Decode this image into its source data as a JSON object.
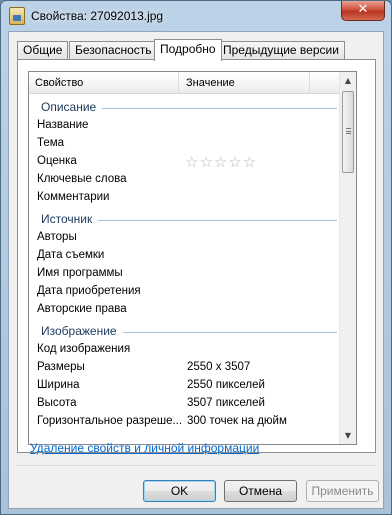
{
  "window": {
    "title": "Свойства: 27092013.jpg",
    "close_symbol": "✕"
  },
  "tabs": [
    {
      "label": "Общие",
      "active": false
    },
    {
      "label": "Безопасность",
      "active": false
    },
    {
      "label": "Подробно",
      "active": true
    },
    {
      "label": "Предыдущие версии",
      "active": false
    }
  ],
  "columns": {
    "property": "Свойство",
    "value": "Значение"
  },
  "groups": {
    "description": {
      "label": "Описание",
      "rows": [
        {
          "key": "Название",
          "value": ""
        },
        {
          "key": "Тема",
          "value": ""
        },
        {
          "key": "Оценка",
          "rating_stars": "☆☆☆☆☆",
          "rating": 0
        },
        {
          "key": "Ключевые слова",
          "value": ""
        },
        {
          "key": "Комментарии",
          "value": ""
        }
      ]
    },
    "source": {
      "label": "Источник",
      "rows": [
        {
          "key": "Авторы",
          "value": ""
        },
        {
          "key": "Дата съемки",
          "value": ""
        },
        {
          "key": "Имя программы",
          "value": ""
        },
        {
          "key": "Дата приобретения",
          "value": ""
        },
        {
          "key": "Авторские права",
          "value": ""
        }
      ]
    },
    "image": {
      "label": "Изображение",
      "rows": [
        {
          "key": "Код изображения",
          "value": ""
        },
        {
          "key": "Размеры",
          "value": "2550 x 3507"
        },
        {
          "key": "Ширина",
          "value": "2550 пикселей"
        },
        {
          "key": "Высота",
          "value": "3507 пикселей"
        },
        {
          "key": "Горизонтальное разреше...",
          "value": "300 точек на дюйм"
        }
      ]
    }
  },
  "scrollbar": {
    "up_arrow": "▲",
    "down_arrow": "▼"
  },
  "remove_link": "Удаление свойств и личной информации",
  "buttons": {
    "ok": "OK",
    "cancel": "Отмена",
    "apply": "Применить"
  }
}
